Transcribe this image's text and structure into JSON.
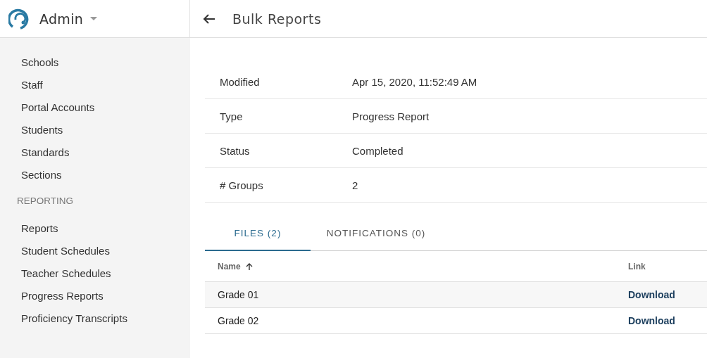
{
  "app": {
    "title": "Admin"
  },
  "page": {
    "title": "Bulk Reports"
  },
  "sidebar": {
    "sections": [
      {
        "items": [
          {
            "label": "Schools"
          },
          {
            "label": "Staff"
          },
          {
            "label": "Portal Accounts"
          },
          {
            "label": "Students"
          },
          {
            "label": "Standards"
          },
          {
            "label": "Sections"
          }
        ]
      },
      {
        "heading": "REPORTING",
        "items": [
          {
            "label": "Reports"
          },
          {
            "label": "Student Schedules"
          },
          {
            "label": "Teacher Schedules"
          },
          {
            "label": "Progress Reports"
          },
          {
            "label": "Proficiency Transcripts"
          }
        ]
      }
    ]
  },
  "details": [
    {
      "label": "Modified",
      "value": "Apr 15, 2020, 11:52:49 AM"
    },
    {
      "label": "Type",
      "value": "Progress Report"
    },
    {
      "label": "Status",
      "value": "Completed"
    },
    {
      "label": "# Groups",
      "value": "2"
    }
  ],
  "tabs": [
    {
      "label": "FILES (2)",
      "selected": true
    },
    {
      "label": "NOTIFICATIONS (0)",
      "selected": false
    }
  ],
  "table": {
    "columns": [
      {
        "label": "Name",
        "sorted": true
      },
      {
        "label": "Link",
        "sorted": false
      }
    ],
    "rows": [
      {
        "name": "Grade 01",
        "link": "Download"
      },
      {
        "name": "Grade 02",
        "link": "Download"
      }
    ]
  }
}
